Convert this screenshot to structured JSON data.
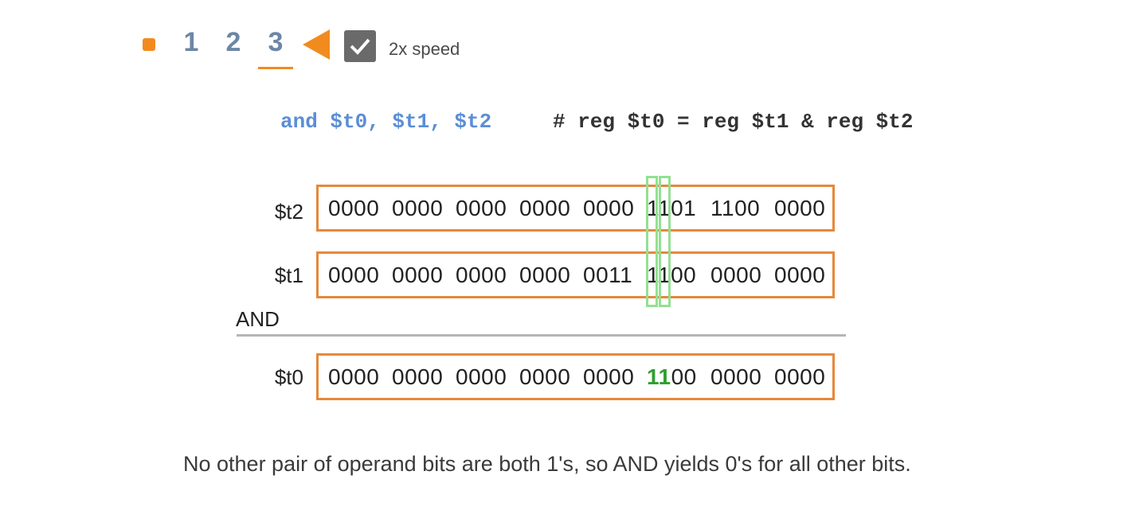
{
  "controls": {
    "steps": [
      "1",
      "2",
      "3"
    ],
    "active_step": 3,
    "speed_label": "2x speed",
    "speed_checked": true,
    "accent_color": "#f28b1e",
    "icons": [
      "stop-icon",
      "triangle-left-icon",
      "checkmark-icon"
    ]
  },
  "instruction": {
    "code": "and $t0, $t1, $t2",
    "comment": "# reg $t0 = reg $t1 & reg $t2"
  },
  "registers": {
    "t2": {
      "label": "$t2",
      "nibbles": [
        "0000",
        "0000",
        "0000",
        "0000",
        "0000",
        "1101",
        "1100",
        "0000"
      ]
    },
    "t1": {
      "label": "$t1",
      "nibbles": [
        "0000",
        "0000",
        "0000",
        "0000",
        "0011",
        "1100",
        "0000",
        "0000"
      ]
    },
    "t0": {
      "label": "$t0",
      "nibbles": [
        "0000",
        "0000",
        "0000",
        "0000",
        "0000",
        "1100",
        "0000",
        "0000"
      ],
      "highlighted_bits": "11",
      "highlighted_rest": "00"
    }
  },
  "operation_label": "AND",
  "caption": "No other pair of operand bits are both 1's, so AND yields 0's for all other bits.",
  "colors": {
    "register_border": "#e6883a",
    "bit_highlight": "#93e093",
    "result_bits": "#2ca02c",
    "code": "#5b8ed6"
  }
}
